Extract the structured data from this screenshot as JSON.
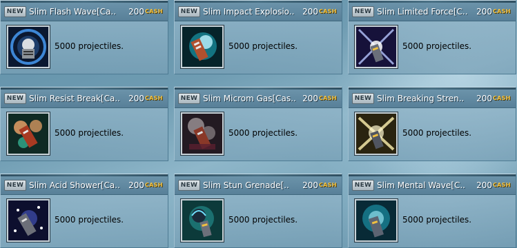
{
  "badge_label": "NEW",
  "currency_label": "CASH",
  "items": [
    {
      "name": "Slim Flash Wave[Ca..",
      "price": "200",
      "description": "5000 projectiles.",
      "icon": "flash-wave-icon"
    },
    {
      "name": "Slim Impact Explosio..",
      "price": "200",
      "description": "5000 projectiles.",
      "icon": "impact-explosion-icon"
    },
    {
      "name": "Slim Limited Force[C..",
      "price": "200",
      "description": "5000 projectiles.",
      "icon": "limited-force-icon"
    },
    {
      "name": "Slim Resist Break[Ca..",
      "price": "200",
      "description": "5000 projectiles.",
      "icon": "resist-break-icon"
    },
    {
      "name": "Slim Microm Gas[Cas..",
      "price": "200",
      "description": "5000 projectiles.",
      "icon": "microm-gas-icon"
    },
    {
      "name": "Slim Breaking Stren..",
      "price": "200",
      "description": "5000 projectiles.",
      "icon": "breaking-strength-icon"
    },
    {
      "name": "Slim Acid Shower[Ca..",
      "price": "200",
      "description": "5000 projectiles.",
      "icon": "acid-shower-icon"
    },
    {
      "name": "Slim Stun Grenade[..",
      "price": "200",
      "description": "5000 projectiles.",
      "icon": "stun-grenade-icon"
    },
    {
      "name": "Slim Mental Wave[C..",
      "price": "200",
      "description": "5000 projectiles.",
      "icon": "mental-wave-icon"
    }
  ],
  "colors": {
    "cash": "#f2c447",
    "name_text": "#ffffff",
    "description_text": "#000000"
  }
}
